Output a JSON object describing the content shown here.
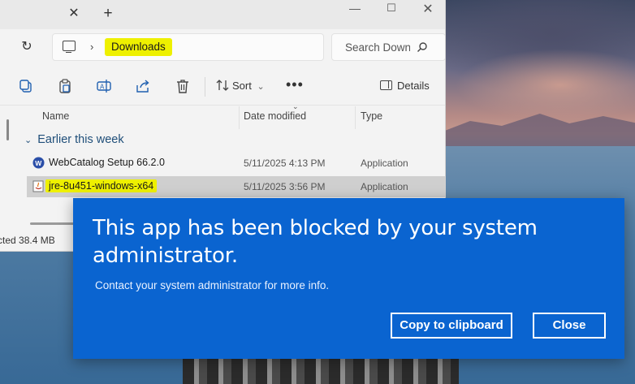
{
  "explorer": {
    "tab_close_glyph": "✕",
    "tab_new_glyph": "+",
    "window_controls": {
      "minimize": "—",
      "maximize": "☐",
      "close": "✕"
    },
    "refresh_glyph": "↻",
    "breadcrumb": {
      "separator": "›",
      "current": "Downloads"
    },
    "search_placeholder": "Search Downloads",
    "toolbar": {
      "sort_label": "Sort",
      "sort_caret": "⌄",
      "more_label": "•••",
      "details_label": "Details"
    },
    "columns": {
      "name": "Name",
      "date_modified": "Date modified",
      "type": "Type",
      "sort_indicator": "⌄"
    },
    "group": {
      "chevron": "⌄",
      "label": "Earlier this week"
    },
    "files": [
      {
        "name": "WebCatalog Setup 66.2.0",
        "date": "5/11/2025 4:13 PM",
        "type": "Application",
        "icon": "webcatalog-app-icon",
        "selected": false,
        "highlighted": false
      },
      {
        "name": "jre-8u451-windows-x64",
        "date": "5/11/2025 3:56 PM",
        "type": "Application",
        "icon": "java-installer-icon",
        "selected": true,
        "highlighted": true
      }
    ],
    "status_text": "cted  38.4 MB",
    "highlight_color": "#eef000"
  },
  "dialog": {
    "title": "This app has been blocked by your system administrator.",
    "message": "Contact your system administrator for more info.",
    "copy_button": "Copy to clipboard",
    "close_button": "Close",
    "background_color": "#0a64d0"
  }
}
